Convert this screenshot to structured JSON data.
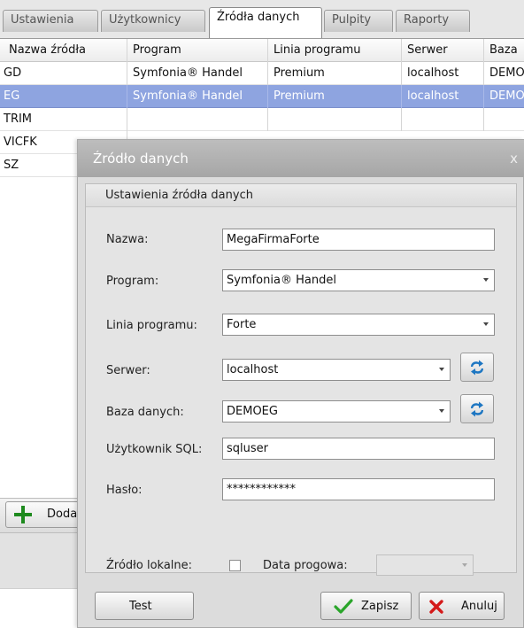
{
  "tabs": [
    {
      "label": "Ustawienia",
      "active": false
    },
    {
      "label": "Użytkownicy",
      "active": false
    },
    {
      "label": "Źródła danych",
      "active": true
    },
    {
      "label": "Pulpity",
      "active": false
    },
    {
      "label": "Raporty",
      "active": false
    }
  ],
  "grid": {
    "columns": [
      "Nazwa źródła",
      "Program",
      "Linia programu",
      "Serwer",
      "Baza"
    ],
    "rows": [
      [
        "GD",
        "Symfonia® Handel",
        "Premium",
        "localhost",
        "DEMO"
      ],
      [
        "EG",
        "Symfonia® Handel",
        "Premium",
        "localhost",
        "DEMO"
      ],
      [
        "TRIM",
        "",
        "",
        "",
        ""
      ],
      [
        "VICFK",
        "",
        "",
        "",
        ""
      ],
      [
        "SZ",
        "",
        "",
        "",
        ""
      ]
    ],
    "selected_row": 1
  },
  "left_panel": {
    "add_button_label": "Doda"
  },
  "dialog": {
    "title": "Źródło danych",
    "close_symbol": "x",
    "group_title": "Ustawienia źródła danych",
    "fields": {
      "name": {
        "label": "Nazwa:",
        "value": "MegaFirmaForte"
      },
      "program": {
        "label": "Program:",
        "value": "Symfonia® Handel"
      },
      "program_line": {
        "label": "Linia programu:",
        "value": "Forte"
      },
      "server": {
        "label": "Serwer:",
        "value": "localhost"
      },
      "database": {
        "label": "Baza danych:",
        "value": "DEMOEG"
      },
      "sql_user": {
        "label": "Użytkownik SQL:",
        "value": "sqluser"
      },
      "password": {
        "label": "Hasło:",
        "value": "************"
      }
    },
    "local_source_label": "Źródło lokalne:",
    "local_source_checked": false,
    "threshold_date_label": "Data progowa:",
    "threshold_date_value": "",
    "buttons": {
      "test": "Test",
      "save": "Zapisz",
      "cancel": "Anuluj"
    }
  },
  "colors": {
    "selection": "#8ea4e0",
    "save_check": "#2aa52a",
    "cancel_x": "#d41a1a",
    "add_plus": "#1e8a1e",
    "refresh_icon": "#1d76c2"
  }
}
